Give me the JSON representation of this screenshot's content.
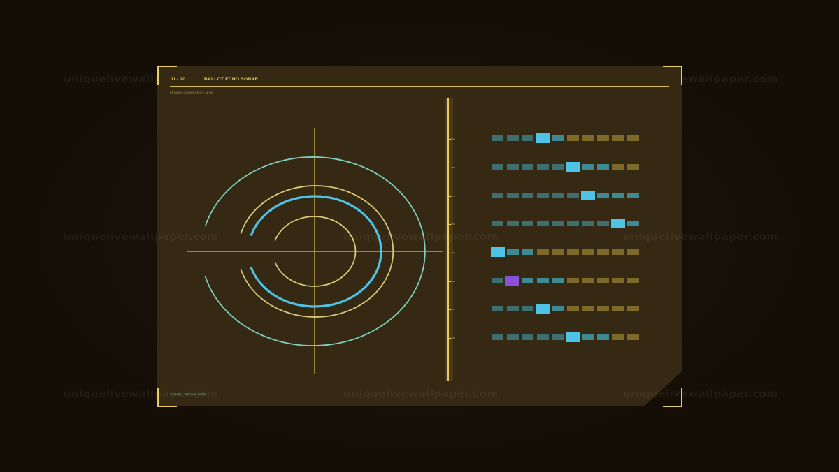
{
  "header": {
    "id": "01 / 02",
    "title": "BALLOT ECHO SONAR",
    "subtitle": "RETURNS CONVERGENCE 94.7%"
  },
  "footer": {
    "label": "CHAN-04 · TACTICAL SWEEP"
  },
  "watermark": "uniquelivewallpaper.com",
  "scale": {
    "ticks": [
      "0.91",
      "0.82",
      "0.73",
      "0.64",
      "0.55",
      "0.46",
      "0.37",
      "0.28"
    ]
  },
  "bars": {
    "columns": 10,
    "rows": [
      {
        "active": 3,
        "highlight": "cyan"
      },
      {
        "active": 5,
        "highlight": "cyan"
      },
      {
        "active": 6,
        "highlight": "cyan"
      },
      {
        "active": 8,
        "highlight": "cyan"
      },
      {
        "active": 0,
        "highlight": "cyan"
      },
      {
        "active": 1,
        "highlight": "purple"
      },
      {
        "active": 3,
        "highlight": "cyan"
      },
      {
        "active": 5,
        "highlight": "cyan"
      }
    ]
  },
  "colors": {
    "accent": "#e8cb62",
    "cyan": "#4fc3e6",
    "purple": "#8a52d9",
    "teal_cell": "#3d6f70",
    "teal_bright": "#3e8a92",
    "olive_cell": "#7d6a29",
    "panel": "#352913"
  }
}
